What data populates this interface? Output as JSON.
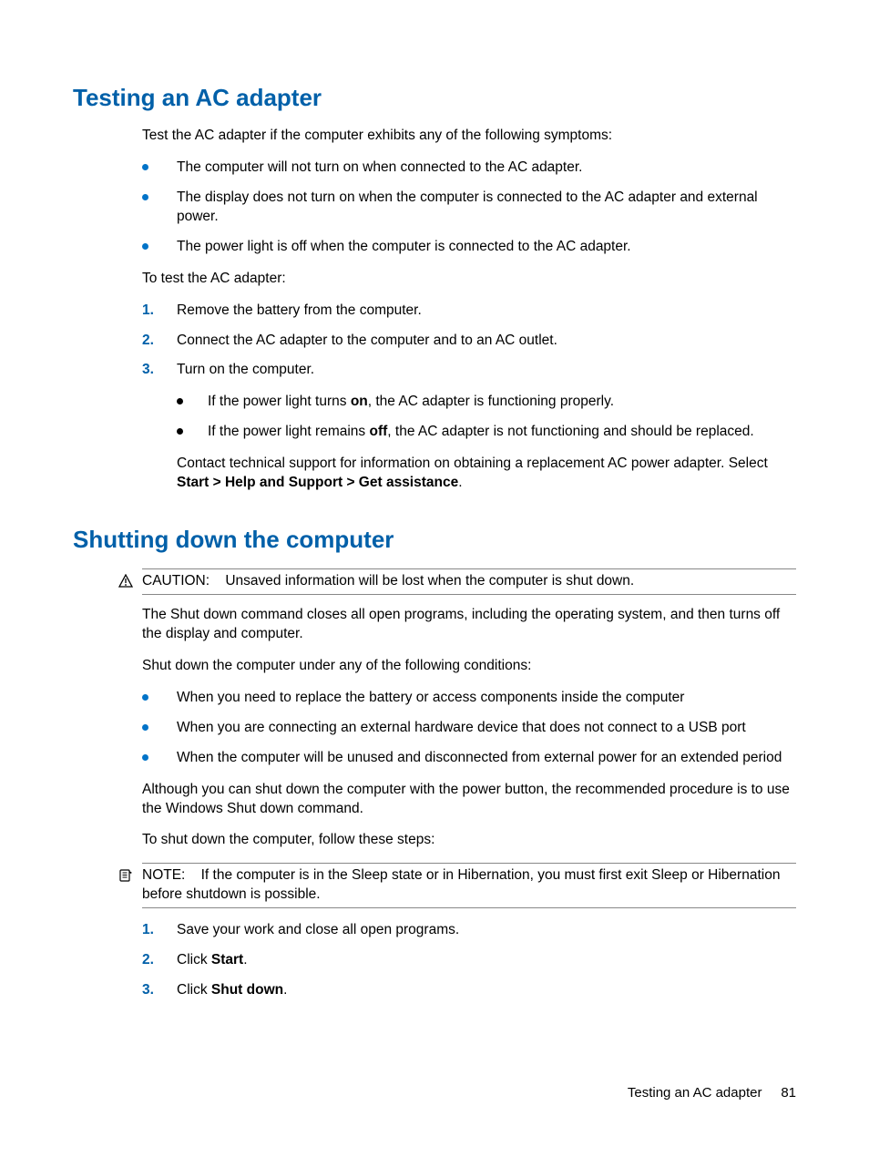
{
  "s1": {
    "heading": "Testing an AC adapter",
    "intro": "Test the AC adapter if the computer exhibits any of the following symptoms:",
    "symptoms": [
      "The computer will not turn on when connected to the AC adapter.",
      "The display does not turn on when the computer is connected to the AC adapter and external power.",
      "The power light is off when the computer is connected to the AC adapter."
    ],
    "to_test": "To test the AC adapter:",
    "steps": [
      "Remove the battery from the computer.",
      "Connect the AC adapter to the computer and to an AC outlet.",
      "Turn on the computer."
    ],
    "step3sub": {
      "a_pre": "If the power light turns ",
      "a_bold": "on",
      "a_post": ", the AC adapter is functioning properly.",
      "b_pre": "If the power light remains ",
      "b_bold": "off",
      "b_post": ", the AC adapter is not functioning and should be replaced."
    },
    "contact_pre": "Contact technical support for information on obtaining a replacement AC power adapter. Select ",
    "contact_bold": "Start > Help and Support > Get assistance",
    "contact_post": "."
  },
  "s2": {
    "heading": "Shutting down the computer",
    "caution_label": "CAUTION:",
    "caution_text": "Unsaved information will be lost when the computer is shut down.",
    "p1": "The Shut down command closes all open programs, including the operating system, and then turns off the display and computer.",
    "p2": "Shut down the computer under any of the following conditions:",
    "conds": [
      "When you need to replace the battery or access components inside the computer",
      "When you are connecting an external hardware device that does not connect to a USB port",
      "When the computer will be unused and disconnected from external power for an extended period"
    ],
    "p3": "Although you can shut down the computer with the power button, the recommended procedure is to use the Windows Shut down command.",
    "p4": "To shut down the computer, follow these steps:",
    "note_label": "NOTE:",
    "note_text": "If the computer is in the Sleep state or in Hibernation, you must first exit Sleep or Hibernation before shutdown is possible.",
    "steps": {
      "s1": "Save your work and close all open programs.",
      "s2_pre": "Click ",
      "s2_bold": "Start",
      "s2_post": ".",
      "s3_pre": "Click ",
      "s3_bold": "Shut down",
      "s3_post": "."
    }
  },
  "footer": {
    "title": "Testing an AC adapter",
    "page": "81"
  }
}
